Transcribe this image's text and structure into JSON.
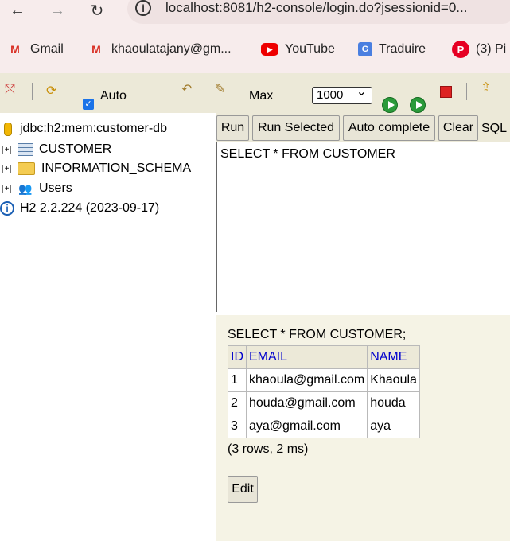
{
  "browser": {
    "url": "localhost:8081/h2-console/login.do?jsessionid=0..."
  },
  "bookmarks": [
    {
      "label": "Gmail",
      "icon": "gmail-icon"
    },
    {
      "label": "khaoulatajany@gm...",
      "icon": "gmail-icon"
    },
    {
      "label": "YouTube",
      "icon": "youtube-icon"
    },
    {
      "label": "Traduire",
      "icon": "translate-icon"
    },
    {
      "label": "(3) Pi",
      "icon": "pinterest-icon"
    }
  ],
  "toolbar": {
    "auto_label": "Auto",
    "auto_checked": true,
    "max_label": "Max",
    "max_value": "1000"
  },
  "tree": {
    "connection": "jdbc:h2:mem:customer-db",
    "items": [
      "CUSTOMER",
      "INFORMATION_SCHEMA",
      "Users"
    ],
    "version": "H2 2.2.224 (2023-09-17)"
  },
  "sql": {
    "buttons": {
      "run": "Run",
      "run_selected": "Run Selected",
      "auto_complete": "Auto complete",
      "clear": "Clear"
    },
    "label": "SQL",
    "query": "SELECT * FROM CUSTOMER"
  },
  "results": {
    "query": "SELECT * FROM CUSTOMER;",
    "columns": [
      "ID",
      "EMAIL",
      "NAME"
    ],
    "rows": [
      [
        "1",
        "khaoula@gmail.com",
        "Khaoula"
      ],
      [
        "2",
        "houda@gmail.com",
        "houda"
      ],
      [
        "3",
        "aya@gmail.com",
        "aya"
      ]
    ],
    "summary": "(3 rows, 2 ms)",
    "edit_label": "Edit"
  }
}
